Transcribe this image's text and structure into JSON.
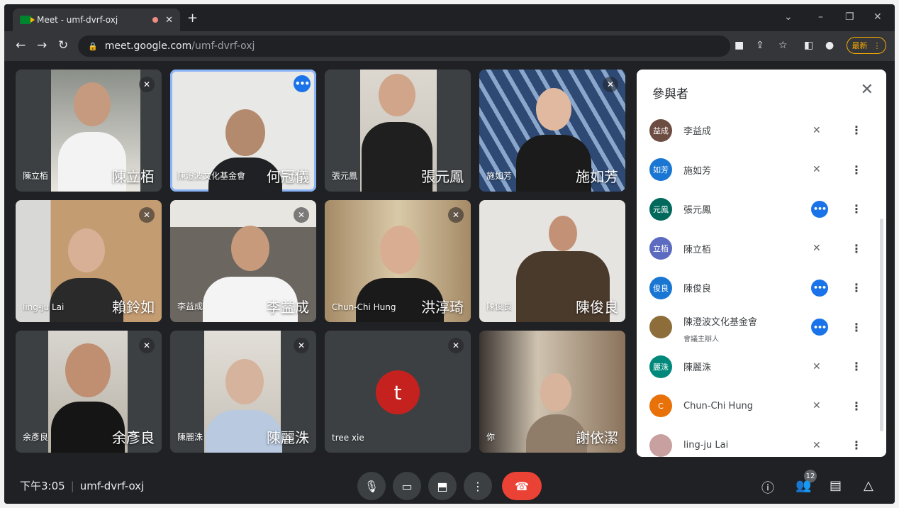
{
  "browser": {
    "tab_title": "Meet - umf-dvrf-oxj",
    "url_host": "meet.google.com",
    "url_path": "/umf-dvrf-oxj",
    "update_label": "最新"
  },
  "tiles": [
    {
      "caption": "陳立栢",
      "big_name": "陳立栢",
      "state": "muted"
    },
    {
      "caption": "陳澄波文化基金會",
      "big_name": "何冠儀",
      "state": "speaking"
    },
    {
      "caption": "張元鳳",
      "big_name": "張元鳳",
      "state": "none"
    },
    {
      "caption": "施如芳",
      "big_name": "施如芳",
      "state": "muted"
    },
    {
      "caption": "ling-ju Lai",
      "big_name": "賴鈴如",
      "state": "muted"
    },
    {
      "caption": "李益成",
      "big_name": "李益成",
      "state": "muted"
    },
    {
      "caption": "Chun-Chi Hung",
      "big_name": "洪淳琦",
      "state": "muted"
    },
    {
      "caption": "陳俊良",
      "big_name": "陳俊良",
      "state": "none"
    },
    {
      "caption": "余彥良",
      "big_name": "余彥良",
      "state": "muted"
    },
    {
      "caption": "陳麗洙",
      "big_name": "陳麗洙",
      "state": "muted"
    },
    {
      "caption": "tree xie",
      "big_name": "",
      "avatar_letter": "t",
      "state": "muted"
    },
    {
      "caption": "你",
      "big_name": "謝依潔",
      "state": "none"
    }
  ],
  "bottom": {
    "time": "下午3:05",
    "meeting_code": "umf-dvrf-oxj",
    "participant_count": "12"
  },
  "panel": {
    "title": "參與者",
    "participants": [
      {
        "avatar": "益成",
        "color": "#6d4c41",
        "name": "李益成",
        "sub": "",
        "status": "muted"
      },
      {
        "avatar": "如芳",
        "color": "#1976d2",
        "name": "施如芳",
        "sub": "",
        "status": "muted"
      },
      {
        "avatar": "元鳳",
        "color": "#00695c",
        "name": "張元鳳",
        "sub": "",
        "status": "active"
      },
      {
        "avatar": "立栢",
        "color": "#5c6bc0",
        "name": "陳立栢",
        "sub": "",
        "status": "muted"
      },
      {
        "avatar": "俊良",
        "color": "#1976d2",
        "name": "陳俊良",
        "sub": "",
        "status": "active"
      },
      {
        "avatar": "",
        "color": "#8d6e3b",
        "name": "陳澄波文化基金會",
        "sub": "會議主辦人",
        "status": "active"
      },
      {
        "avatar": "麗洙",
        "color": "#00897b",
        "name": "陳麗洙",
        "sub": "",
        "status": "muted"
      },
      {
        "avatar": "C",
        "color": "#e8710a",
        "name": "Chun-Chi Hung",
        "sub": "",
        "status": "muted"
      },
      {
        "avatar": "",
        "color": "#c9a0a0",
        "name": "ling-ju Lai",
        "sub": "",
        "status": "muted"
      }
    ]
  }
}
